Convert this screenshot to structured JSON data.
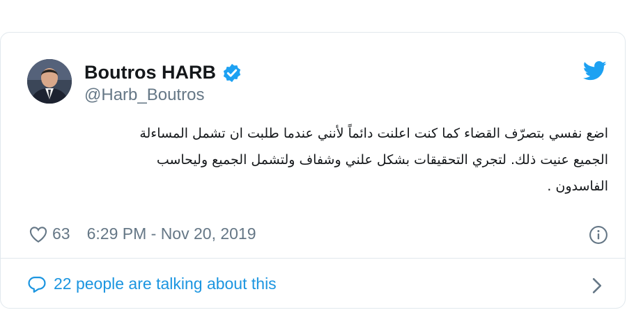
{
  "tweet": {
    "author": {
      "name": "Boutros HARB",
      "handle": "@Harb_Boutros",
      "verified": true
    },
    "text_lines": [
      "اضع نفسي بتصرّف القضاء كما كنت اعلنت دائماً لأنني عندما طلبت ان تشمل المساءلة",
      "الجميع عنيت ذلك. لتجري  التحقيقات بشكل علني وشفاف ولتشمل الجميع وليحاسب",
      "الفاسدون ."
    ],
    "likes": "63",
    "timestamp": "6:29 PM - Nov 20, 2019",
    "conversation_text": "22 people are talking about this"
  },
  "icons": {
    "verified": "verified-badge-icon",
    "brand": "twitter-bird-icon",
    "like": "heart-icon",
    "info": "info-icon",
    "conversation": "speech-bubble-icon",
    "chevron": "chevron-right-icon"
  },
  "colors": {
    "brand_blue": "#1da1f2",
    "link_blue": "#1b95e0",
    "secondary_text": "#657786",
    "border": "#e1e8ed"
  }
}
